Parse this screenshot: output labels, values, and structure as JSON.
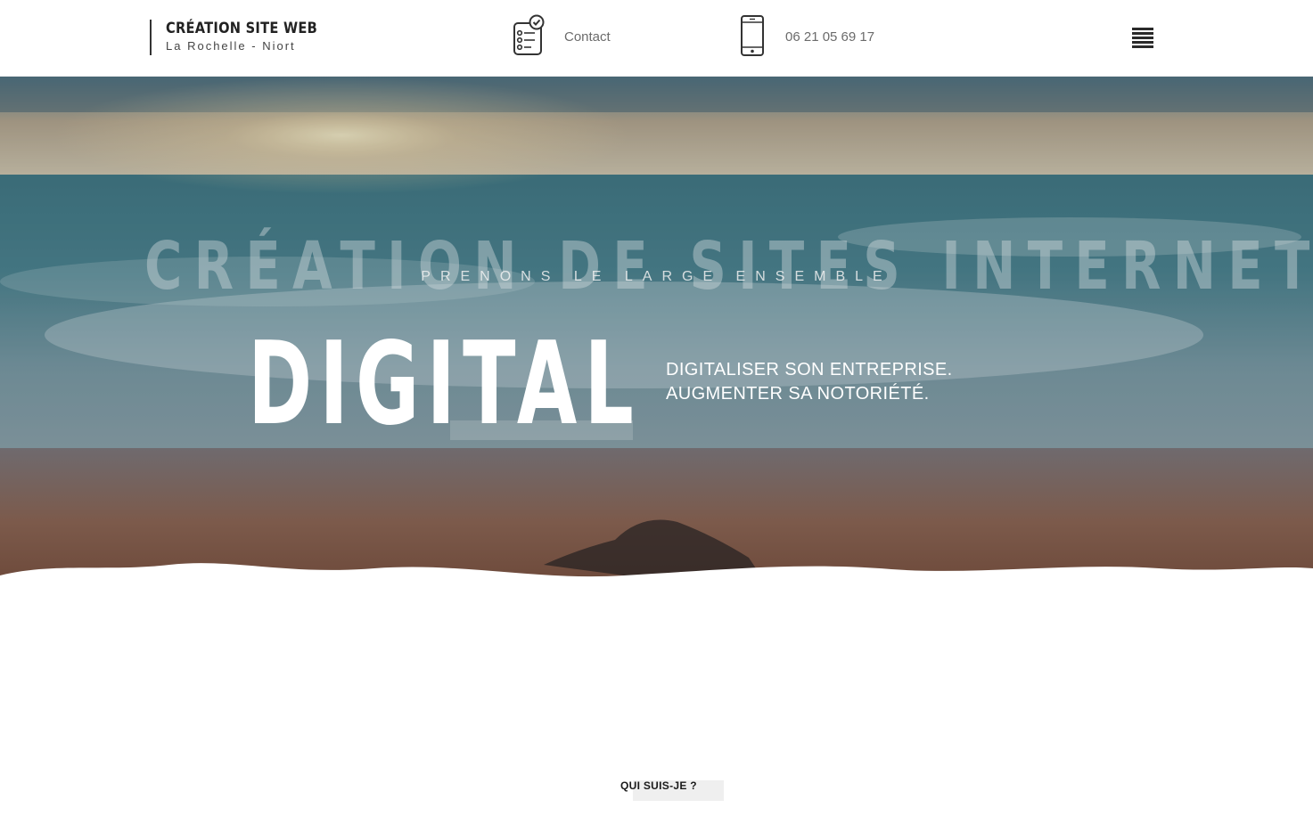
{
  "header": {
    "brand_title": "CRÉATION SITE WEB",
    "brand_subtitle": "La Rochelle - Niort",
    "contact_label": "Contact",
    "phone": "06 21 05 69 17",
    "icons": {
      "contact": "form-checklist-icon",
      "phone": "smartphone-icon",
      "menu": "hamburger-menu-icon"
    }
  },
  "hero": {
    "background_title": "CRÉATION DE SITES INTERNET",
    "kicker": "PRENONS LE LARGE ENSEMBLE",
    "headline": "DIGITAL",
    "line1": "DIGITALISER SON ENTREPRISE.",
    "line2": "AUGMENTER SA NOTORIÉTÉ."
  },
  "section": {
    "label": "QUI SUIS-JE ?"
  },
  "colors": {
    "text_dark": "#222222",
    "text_muted": "#6b6b6b",
    "sea": "#3d6f7c",
    "sand": "#7a5546",
    "white": "#ffffff"
  }
}
